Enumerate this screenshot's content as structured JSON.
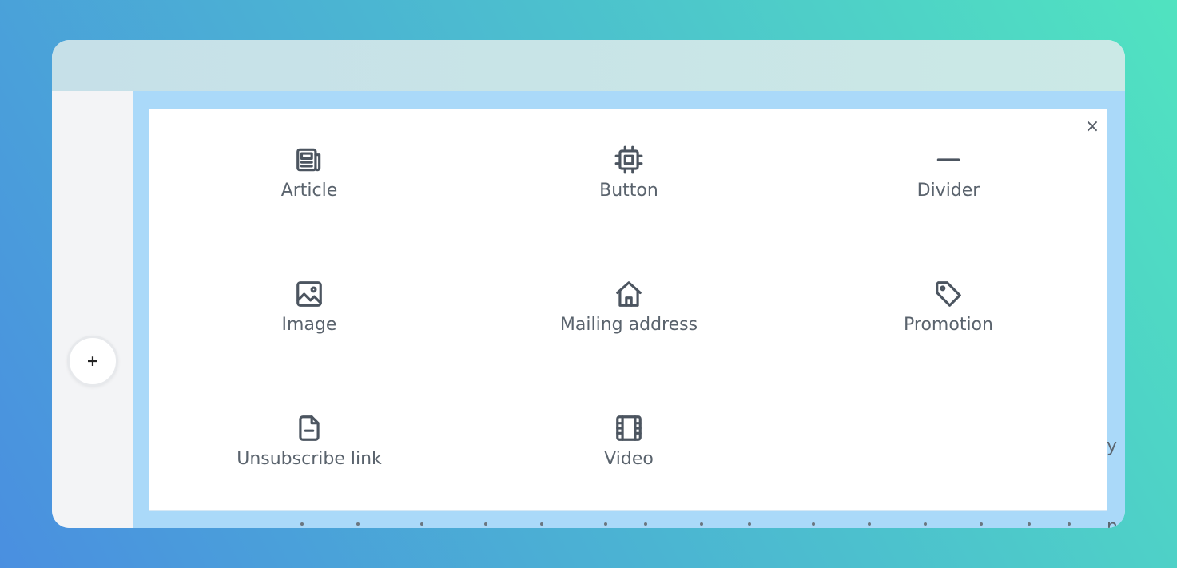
{
  "add_button": {
    "label": "+"
  },
  "background_text": {
    "line1_tail": "y",
    "line2_tail": "n"
  },
  "panel": {
    "close_label": "×",
    "items": [
      {
        "label": "Article",
        "icon": "article-icon"
      },
      {
        "label": "Button",
        "icon": "button-icon"
      },
      {
        "label": "Divider",
        "icon": "divider-icon"
      },
      {
        "label": "Image",
        "icon": "image-icon"
      },
      {
        "label": "Mailing address",
        "icon": "home-icon"
      },
      {
        "label": "Promotion",
        "icon": "tag-icon"
      },
      {
        "label": "Unsubscribe link",
        "icon": "file-minus-icon"
      },
      {
        "label": "Video",
        "icon": "film-icon"
      }
    ]
  },
  "colors": {
    "canvas": "#aad9f9",
    "topbar": "#c6e0e8",
    "icon": "#4c5560",
    "label": "#5a636d"
  }
}
